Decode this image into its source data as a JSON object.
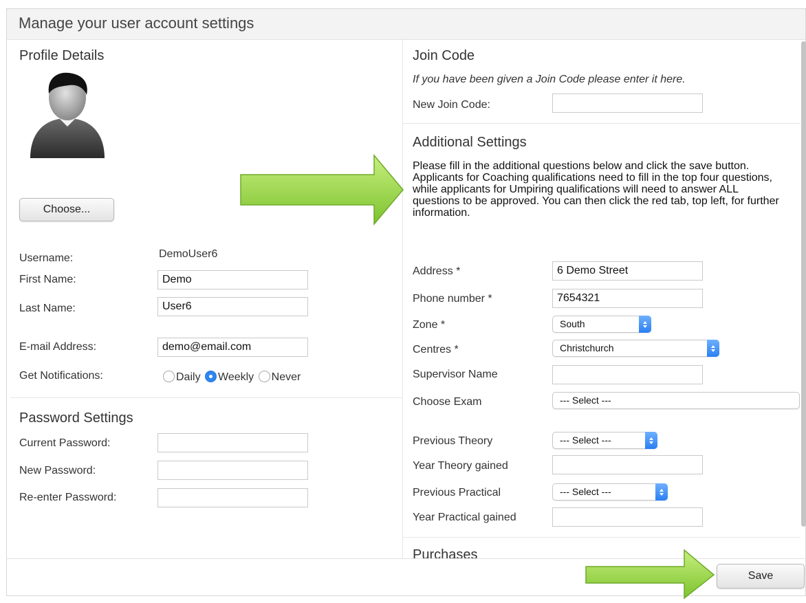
{
  "dialog": {
    "title": "Manage your user account settings"
  },
  "profile": {
    "heading": "Profile Details",
    "choose_button": "Choose...",
    "username_label": "Username:",
    "username_value": "DemoUser6",
    "first_name_label": "First Name:",
    "first_name_value": "Demo",
    "last_name_label": "Last Name:",
    "last_name_value": "User6",
    "email_label": "E-mail Address:",
    "email_value": "demo@email.com",
    "notifications_label": "Get Notifications:",
    "notification_options": [
      "Daily",
      "Weekly",
      "Never"
    ],
    "notification_selected": "Weekly"
  },
  "password": {
    "heading": "Password Settings",
    "current_label": "Current Password:",
    "new_label": "New Password:",
    "reenter_label": "Re-enter Password:"
  },
  "join_code": {
    "heading": "Join Code",
    "hint": "If you have been given a Join Code please enter it here.",
    "label": "New Join Code:",
    "value": ""
  },
  "additional": {
    "heading": "Additional Settings",
    "instructions": "Please fill in the additional questions below and click the save button. Applicants for Coaching qualifications need to fill in the top four questions, while applicants for Umpiring qualifications will need to answer ALL questions to be approved. You can then click the red tab, top left, for further information.",
    "address_label": "Address *",
    "address_value": "6 Demo Street",
    "phone_label": "Phone number *",
    "phone_value": "7654321",
    "zone_label": "Zone *",
    "zone_value": "South",
    "centres_label": "Centres *",
    "centres_value": "Christchurch",
    "supervisor_label": "Supervisor Name",
    "supervisor_value": "",
    "exam_label": "Choose Exam",
    "exam_value": "--- Select ---",
    "prev_theory_label": "Previous Theory",
    "prev_theory_value": "--- Select ---",
    "year_theory_label": "Year Theory gained",
    "year_theory_value": "",
    "prev_practical_label": "Previous Practical",
    "prev_practical_value": "--- Select ---",
    "year_practical_label": "Year Practical gained",
    "year_practical_value": ""
  },
  "purchases": {
    "heading": "Purchases"
  },
  "footer": {
    "save_button": "Save"
  },
  "colors": {
    "arrow_green": "#8fd13f",
    "radio_blue": "#2f86f1"
  }
}
